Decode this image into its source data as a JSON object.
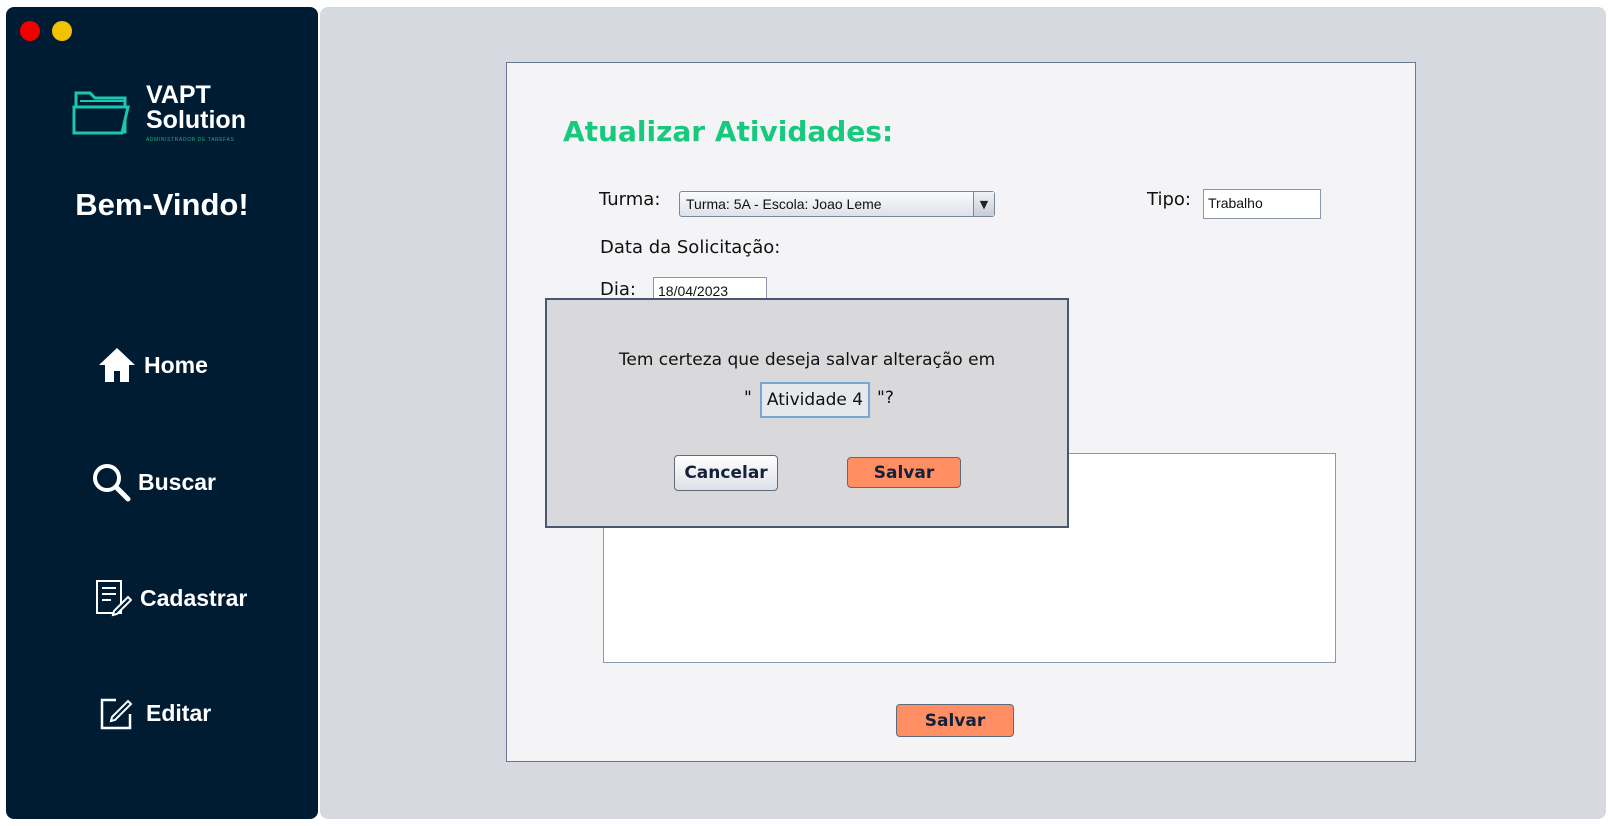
{
  "window": {
    "controls": [
      "close",
      "minimize"
    ]
  },
  "sidebar": {
    "logo": {
      "line1": "VAPT",
      "line2": "Solution",
      "tagline": "ADMINISTRADOR DE TAREFAS",
      "icon": "folder-icon"
    },
    "welcome": "Bem-Vindo!",
    "items": [
      {
        "label": "Home",
        "icon": "home-icon"
      },
      {
        "label": "Buscar",
        "icon": "search-icon"
      },
      {
        "label": "Cadastrar",
        "icon": "form-edit-icon"
      },
      {
        "label": "Editar",
        "icon": "edit-icon"
      }
    ]
  },
  "form": {
    "title": "Atualizar Atividades:",
    "turma_label": "Turma:",
    "turma_value": "Turma: 5A - Escola: Joao Leme",
    "tipo_label": "Tipo:",
    "tipo_value": "Trabalho",
    "data_label": "Data da Solicitação:",
    "dia_label": "Dia:",
    "dia_value": "18/04/2023",
    "save_label": "Salvar"
  },
  "dialog": {
    "message": "Tem certeza que deseja salvar alteração em",
    "quote_open": "\"",
    "quote_close": "\"?",
    "activity_name": "Atividade  4",
    "cancel_label": "Cancelar",
    "save_label": "Salvar"
  },
  "colors": {
    "sidebar_bg": "#001c33",
    "accent_green": "#17c97d",
    "button_orange": "#ff8e62",
    "main_bg": "#d6d9e0"
  }
}
